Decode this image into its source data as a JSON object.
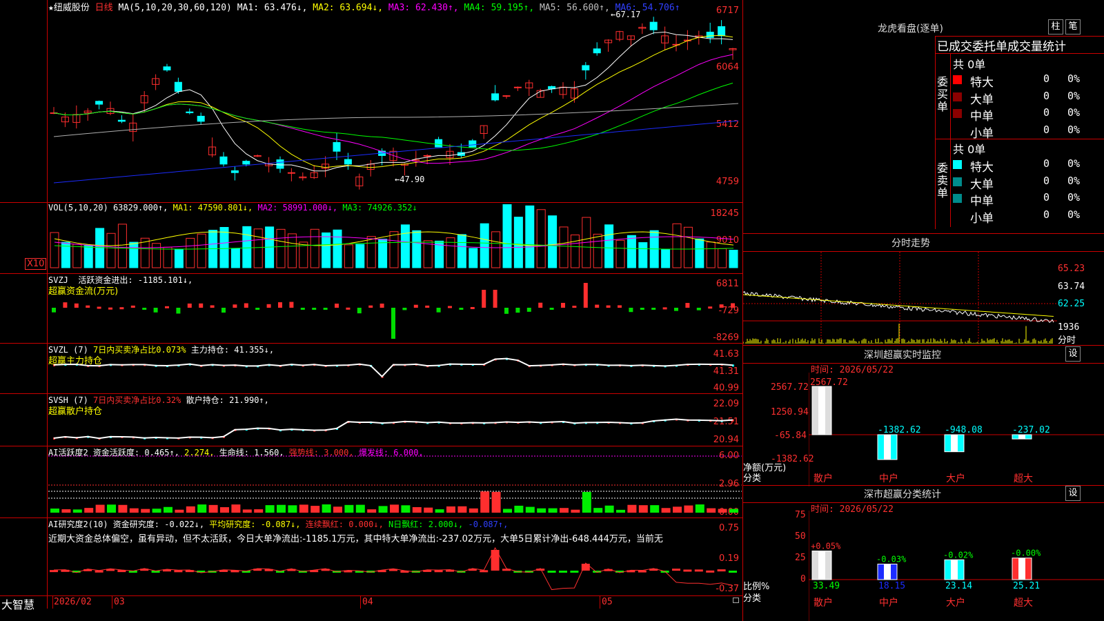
{
  "colors": {
    "up": "#ff2e2e",
    "down": "#00ffff",
    "ma1": "#ffffff",
    "ma2": "#ffff00",
    "ma3": "#ff00ff",
    "ma4": "#00ff00",
    "ma5": "#b0b0b0",
    "ma6": "#1c2cff",
    "panel": "#ff0000"
  },
  "header": {
    "star": "★",
    "stock_name": "纽威股份",
    "period": "日线",
    "ma_params": "MA(5,10,20,30,60,120)",
    "ma1": "MA1: 63.476↓,",
    "ma2": "MA2: 63.694↓,",
    "ma3": "MA3: 62.430↑,",
    "ma4": "MA4: 59.195↑,",
    "ma5": "MA5: 56.600↑,",
    "ma6": "MA6: 54.706↑"
  },
  "price_axis": [
    "6717",
    "6064",
    "5412",
    "4759"
  ],
  "price_high_label": "67.17",
  "price_low_label": "47.90",
  "vol": {
    "axis": [
      "18245",
      "9010",
      "X10"
    ],
    "header_name": "VOL(5,10,20)",
    "header_val": "63829.000↑,",
    "ma1": "MA1: 47590.801↓,",
    "ma2": "MA2: 58991.000↓,",
    "ma3": "MA3: 74926.352↓"
  },
  "svzj": {
    "axis": [
      "6811",
      "-729",
      "-8269"
    ],
    "line1a": "SVZJ",
    "line1b": "活跃资金进出: -1185.101↓,",
    "line2": "超赢资金流(万元)"
  },
  "svzl": {
    "axis": [
      "41.63",
      "41.31",
      "40.99"
    ],
    "line1a": "SVZL (7)",
    "line1b": "7日内买卖净占比0.073%",
    "line1c": "主力持仓: 41.355↓,",
    "line2": "超赢主力持仓"
  },
  "svsh": {
    "axis": [
      "22.09",
      "21.51",
      "20.94"
    ],
    "line1a": "SVSH (7)",
    "line1b": "7日内买卖净占比0.32%",
    "line1c": "散户持仓: 21.990↑,",
    "line2": "超赢散户持仓"
  },
  "ai1": {
    "axis": [
      "6.00",
      "2.96",
      "0.00"
    ],
    "t1": "AI活跃度2 资金活跃度: 0.465↑,",
    "t2": "2.274,",
    "t3": "生命线: 1.560,",
    "t4": "强势线: 3.000,",
    "t5": "爆发线: 6.000,"
  },
  "ai2": {
    "axis": [
      "0.75",
      "0.19",
      "-0.37"
    ],
    "t1": "AI研究度2(10) 资金研究度: -0.022↓,",
    "t2": "平均研究度: -0.087↓,",
    "t3": "连续飘红: 0.000↓,",
    "t4": "N日飘红: 2.000↓,",
    "t5": "-0.087↑,",
    "desc": "近期大资金总体偏空，虽有异动，但不太活跃，今日大单净流出:-1185.1万元，其中特大单净流出:-237.02万元，大单5日累计净出-648.444万元，当前无"
  },
  "bottom": {
    "brand": "大智慧",
    "dates": [
      "2026/02",
      "03",
      "04",
      "05"
    ]
  },
  "lhb": {
    "title": "龙虎看盘(逐单)",
    "btn1": "柱",
    "btn2": "笔",
    "subtitle": "已成交委托单成交量统计",
    "buy_label": "委买单",
    "sell_label": "委卖单",
    "buy_total": "共 0单",
    "sell_total": "共 0单",
    "rows": [
      {
        "name": "特大",
        "val": "0",
        "pct": "0%"
      },
      {
        "name": "大单",
        "val": "0",
        "pct": "0%"
      },
      {
        "name": "中单",
        "val": "0",
        "pct": "0%"
      },
      {
        "name": "小单",
        "val": "0",
        "pct": "0%"
      }
    ]
  },
  "fenshi": {
    "title": "分时走势",
    "axis": [
      "65.23",
      "63.74",
      "62.25",
      "1936"
    ],
    "unit": "分时"
  },
  "szjk": {
    "title": "深圳超赢实时监控",
    "btn": "设",
    "time": "时间: 2026/05/22",
    "axis": [
      "2567.72",
      "1250.94",
      "-65.84",
      "-1382.62"
    ],
    "ylabel1": "净额(万元)",
    "ylabel2": "分类",
    "bars": [
      {
        "label": "2567.72",
        "cat": "散户",
        "value": 2567.72
      },
      {
        "label": "-1382.62",
        "cat": "中户",
        "value": -1382.62
      },
      {
        "label": "-948.08",
        "cat": "大户",
        "value": -948.08
      },
      {
        "label": "-237.02",
        "cat": "超大",
        "value": -237.02
      }
    ]
  },
  "fltj": {
    "title": "深市超赢分类统计",
    "btn": "设",
    "time": "时间: 2026/05/22",
    "axis": [
      "75",
      "50",
      "25",
      "0"
    ],
    "ylabel1": "比例%",
    "ylabel2": "分类",
    "bars": [
      {
        "top": "+0.05%",
        "bottom": "33.49",
        "cat": "散户",
        "value": 33.49
      },
      {
        "top": "-0.03%",
        "bottom": "18.15",
        "cat": "中户",
        "value": 18.15
      },
      {
        "top": "-0.02%",
        "bottom": "23.14",
        "cat": "大户",
        "value": 23.14
      },
      {
        "top": "-0.00%",
        "bottom": "25.21",
        "cat": "超大",
        "value": 25.21
      }
    ]
  },
  "chart_data": {
    "type": "bar",
    "title": "深圳超赢实时监控",
    "categories": [
      "散户",
      "中户",
      "大户",
      "超大"
    ],
    "ylabel": "净额(万元)",
    "values": [
      2567.72,
      -1382.62,
      -948.08,
      -237.02
    ],
    "ylim": [
      -1382.62,
      2567.72
    ]
  }
}
